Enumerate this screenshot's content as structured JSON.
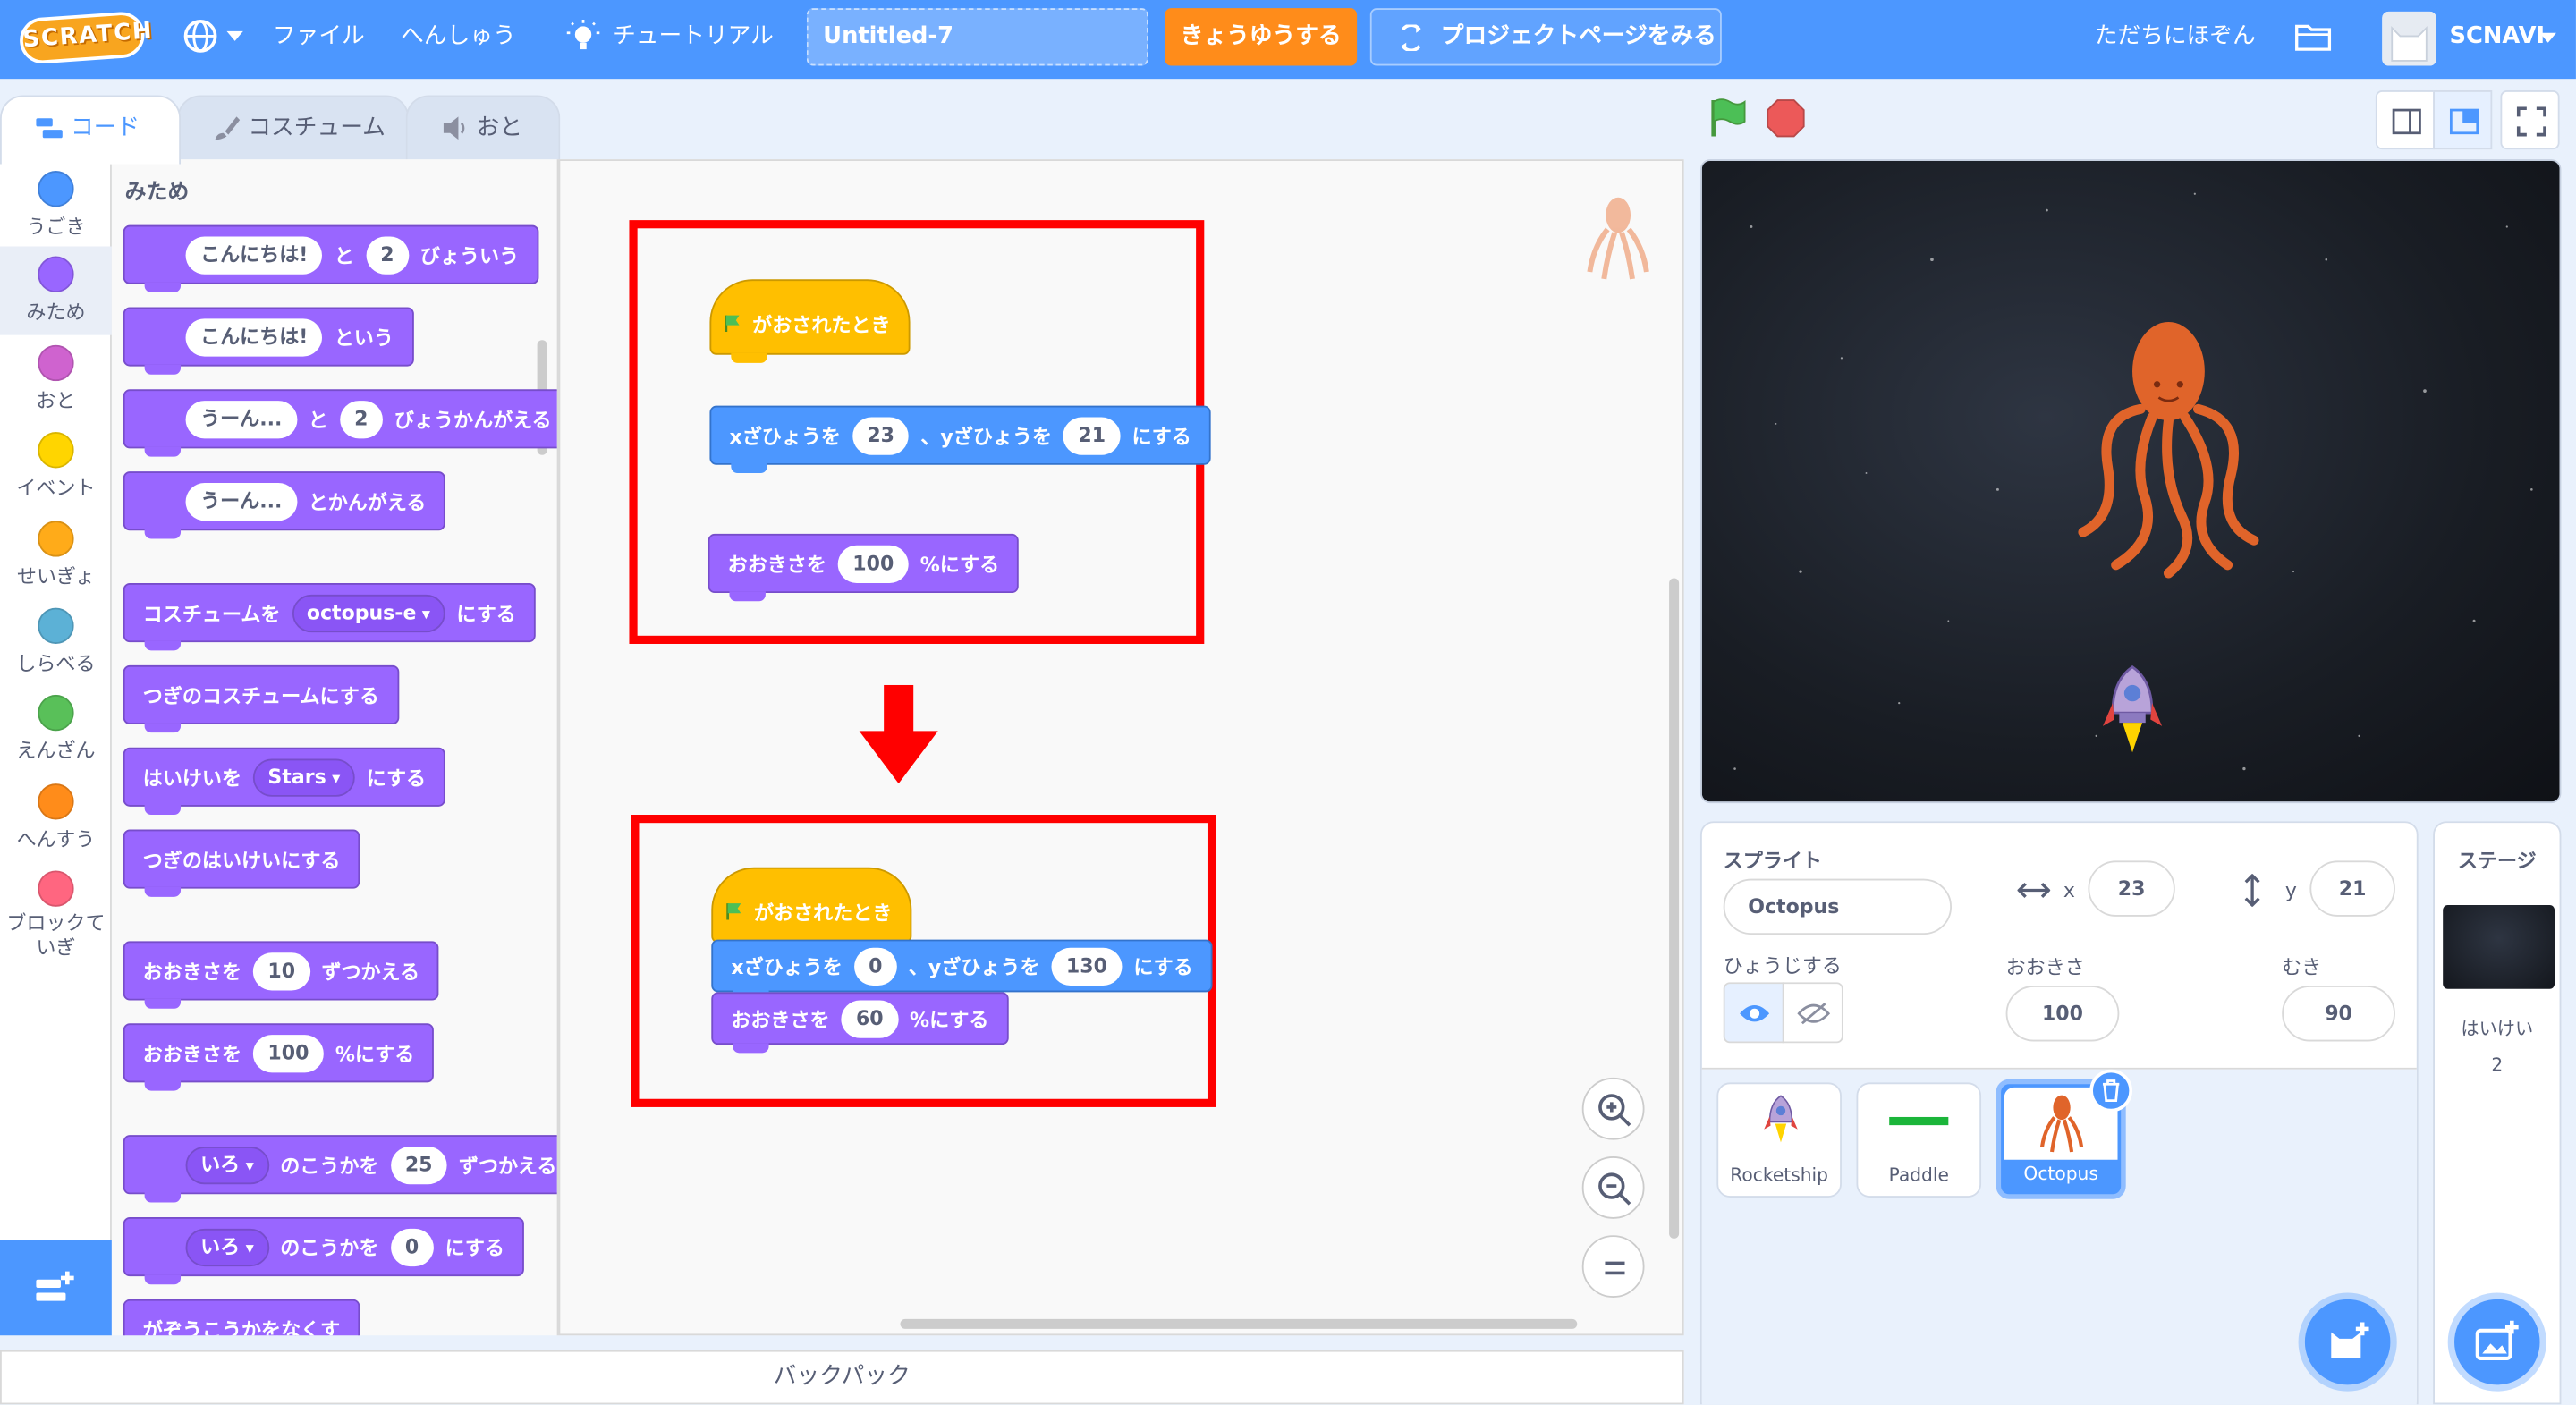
{
  "menubar": {
    "logo": "SCRATCH",
    "file": "ファイル",
    "edit": "へんしゅう",
    "tutorial": "チュートリアル",
    "project_title": "Untitled-7",
    "share": "きょうゆうする",
    "see_project": "プロジェクトページをみる",
    "save_now": "ただちにほぞん",
    "username": "SCNAVI"
  },
  "tabs": {
    "code": "コード",
    "costumes": "コスチューム",
    "sounds": "おと"
  },
  "categories": [
    {
      "label": "うごき",
      "color": "#4c97ff"
    },
    {
      "label": "みため",
      "color": "#9966ff"
    },
    {
      "label": "おと",
      "color": "#cf63cf"
    },
    {
      "label": "イベント",
      "color": "#ffd500"
    },
    {
      "label": "せいぎょ",
      "color": "#ffab19"
    },
    {
      "label": "しらべる",
      "color": "#5cb1d6"
    },
    {
      "label": "えんざん",
      "color": "#59c059"
    },
    {
      "label": "へんすう",
      "color": "#ff8c1a"
    },
    {
      "label": "ブロックていぎ",
      "color": "#ff6680"
    }
  ],
  "palette": {
    "heading": "みため",
    "say_for": {
      "text": "こんにちは!",
      "and": "と",
      "secs": "2",
      "tail": "びょういう"
    },
    "say": {
      "text": "こんにちは!",
      "tail": "という"
    },
    "think_for": {
      "text": "うーん...",
      "and": "と",
      "secs": "2",
      "tail": "びょうかんがえる"
    },
    "think": {
      "text": "うーん...",
      "tail": "とかんがえる"
    },
    "switch_costume": {
      "head": "コスチュームを",
      "value": "octopus-e",
      "tail": "にする"
    },
    "next_costume": "つぎのコスチュームにする",
    "switch_backdrop": {
      "head": "はいけいを",
      "value": "Stars",
      "tail": "にする"
    },
    "next_backdrop": "つぎのはいけいにする",
    "change_size": {
      "head": "おおきさを",
      "value": "10",
      "tail": "ずつかえる"
    },
    "set_size": {
      "head": "おおきさを",
      "value": "100",
      "tail": "%にする"
    },
    "change_effect": {
      "effect": "いろ",
      "mid": "のこうかを",
      "value": "25",
      "tail": "ずつかえる"
    },
    "set_effect": {
      "effect": "いろ",
      "mid": "のこうかを",
      "value": "0",
      "tail": "にする"
    },
    "clear_effects": "がぞうこうかをなくす"
  },
  "scripts": {
    "before": {
      "hat": "がおされたとき",
      "goto": {
        "x_label": "xざひょうを",
        "x": "23",
        "sep": "、yざひょうを",
        "y": "21",
        "tail": "にする"
      },
      "size": {
        "head": "おおきさを",
        "value": "100",
        "tail": "%にする"
      }
    },
    "after": {
      "hat": "がおされたとき",
      "goto": {
        "x_label": "xざひょうを",
        "x": "0",
        "sep": "、yざひょうを",
        "y": "130",
        "tail": "にする"
      },
      "size": {
        "head": "おおきさを",
        "value": "60",
        "tail": "%にする"
      }
    }
  },
  "backpack": "バックパック",
  "sprite_info": {
    "sprite_label": "スプライト",
    "sprite_name": "Octopus",
    "x_label": "x",
    "x": "23",
    "y_label": "y",
    "y": "21",
    "show_label": "ひょうじする",
    "size_label": "おおきさ",
    "size": "100",
    "direction_label": "むき",
    "direction": "90"
  },
  "sprites": [
    {
      "name": "Rocketship"
    },
    {
      "name": "Paddle"
    },
    {
      "name": "Octopus"
    }
  ],
  "stage_panel": {
    "title": "ステージ",
    "backdrops_label": "はいけい",
    "backdrops_count": "2"
  },
  "colors": {
    "menubar": "#4c97ff",
    "looks": "#9966ff",
    "motion": "#4c97ff",
    "events": "#ffbf00",
    "highlight": "#ff0000"
  }
}
